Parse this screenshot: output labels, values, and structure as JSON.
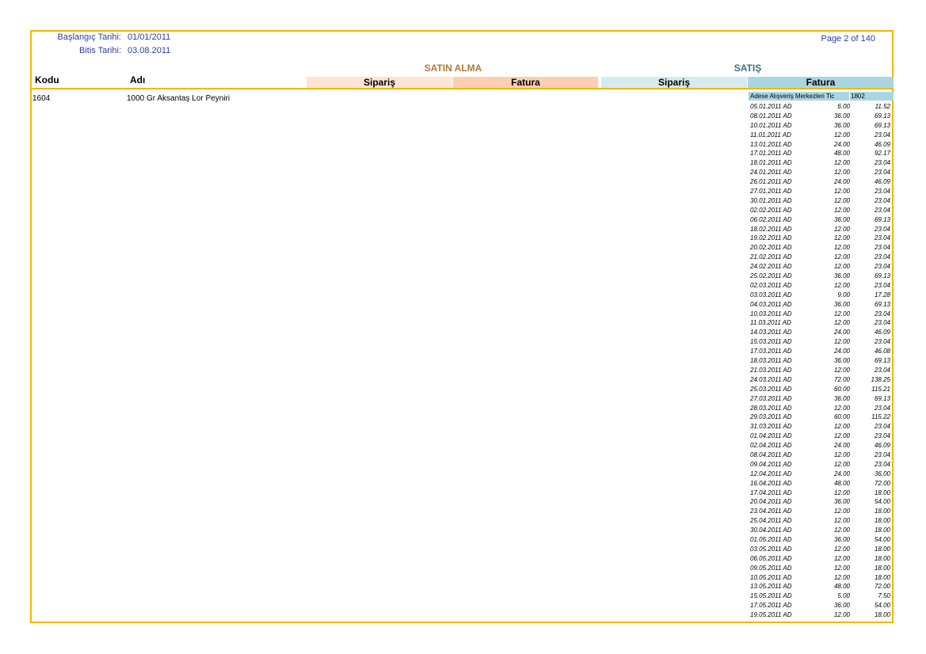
{
  "header": {
    "start_label": "Başlangıç Tarihi:",
    "start_value": "01/01/2011",
    "end_label": "Bitis Tarihi:",
    "end_value": "03.08.2011",
    "page": "Page 2 of 140"
  },
  "sections": {
    "purchase": "SATIN ALMA",
    "sales": "SATIŞ"
  },
  "columns": {
    "code": "Kodu",
    "name": "Adı",
    "purchase_order": "Sipariş",
    "purchase_invoice": "Fatura",
    "sales_order": "Sipariş",
    "sales_invoice": "Fatura"
  },
  "product": {
    "code": "1604",
    "name": "1000 Gr Aksantaş Lor Peyniri"
  },
  "customer": {
    "name": "Adese Alışveriş Merkezleri Tic",
    "code": "1802"
  },
  "lines": [
    {
      "date": "05.01.2011 AD",
      "qty": "6.00",
      "amount": "11.52"
    },
    {
      "date": "08.01.2011 AD",
      "qty": "36.00",
      "amount": "69.13"
    },
    {
      "date": "10.01.2011 AD",
      "qty": "36.00",
      "amount": "69.13"
    },
    {
      "date": "11.01.2011 AD",
      "qty": "12.00",
      "amount": "23.04"
    },
    {
      "date": "13.01.2011 AD",
      "qty": "24.00",
      "amount": "46.09"
    },
    {
      "date": "17.01.2011 AD",
      "qty": "48.00",
      "amount": "92.17"
    },
    {
      "date": "18.01.2011 AD",
      "qty": "12.00",
      "amount": "23.04"
    },
    {
      "date": "24.01.2011 AD",
      "qty": "12.00",
      "amount": "23.04"
    },
    {
      "date": "26.01.2011 AD",
      "qty": "24.00",
      "amount": "46.09"
    },
    {
      "date": "27.01.2011 AD",
      "qty": "12.00",
      "amount": "23.04"
    },
    {
      "date": "30.01.2011 AD",
      "qty": "12.00",
      "amount": "23.04"
    },
    {
      "date": "02.02.2011 AD",
      "qty": "12.00",
      "amount": "23.04"
    },
    {
      "date": "06.02.2011 AD",
      "qty": "36.00",
      "amount": "69.13"
    },
    {
      "date": "18.02.2011 AD",
      "qty": "12.00",
      "amount": "23.04"
    },
    {
      "date": "19.02.2011 AD",
      "qty": "12.00",
      "amount": "23.04"
    },
    {
      "date": "20.02.2011 AD",
      "qty": "12.00",
      "amount": "23.04"
    },
    {
      "date": "21.02.2011 AD",
      "qty": "12.00",
      "amount": "23.04"
    },
    {
      "date": "24.02.2011 AD",
      "qty": "12.00",
      "amount": "23.04"
    },
    {
      "date": "25.02.2011 AD",
      "qty": "36.00",
      "amount": "69.13"
    },
    {
      "date": "02.03.2011 AD",
      "qty": "12.00",
      "amount": "23.04"
    },
    {
      "date": "03.03.2011 AD",
      "qty": "9.00",
      "amount": "17.28"
    },
    {
      "date": "04.03.2011 AD",
      "qty": "36.00",
      "amount": "69.13"
    },
    {
      "date": "10.03.2011 AD",
      "qty": "12.00",
      "amount": "23.04"
    },
    {
      "date": "11.03.2011 AD",
      "qty": "12.00",
      "amount": "23.04"
    },
    {
      "date": "14.03.2011 AD",
      "qty": "24.00",
      "amount": "46.09"
    },
    {
      "date": "15.03.2011 AD",
      "qty": "12.00",
      "amount": "23.04"
    },
    {
      "date": "17.03.2011 AD",
      "qty": "24.00",
      "amount": "46.08"
    },
    {
      "date": "18.03.2011 AD",
      "qty": "36.00",
      "amount": "69.13"
    },
    {
      "date": "21.03.2011 AD",
      "qty": "12.00",
      "amount": "23.04"
    },
    {
      "date": "24.03.2011 AD",
      "qty": "72.00",
      "amount": "138.25"
    },
    {
      "date": "25.03.2011 AD",
      "qty": "60.00",
      "amount": "115.21"
    },
    {
      "date": "27.03.2011 AD",
      "qty": "36.00",
      "amount": "69.13"
    },
    {
      "date": "28.03.2011 AD",
      "qty": "12.00",
      "amount": "23.04"
    },
    {
      "date": "29.03.2011 AD",
      "qty": "60.00",
      "amount": "115.22"
    },
    {
      "date": "31.03.2011 AD",
      "qty": "12.00",
      "amount": "23.04"
    },
    {
      "date": "01.04.2011 AD",
      "qty": "12.00",
      "amount": "23.04"
    },
    {
      "date": "02.04.2011 AD",
      "qty": "24.00",
      "amount": "46.09"
    },
    {
      "date": "08.04.2011 AD",
      "qty": "12.00",
      "amount": "23.04"
    },
    {
      "date": "09.04.2011 AD",
      "qty": "12.00",
      "amount": "23.04"
    },
    {
      "date": "12.04.2011 AD",
      "qty": "24.00",
      "amount": "36.00"
    },
    {
      "date": "16.04.2011 AD",
      "qty": "48.00",
      "amount": "72.00"
    },
    {
      "date": "17.04.2011 AD",
      "qty": "12.00",
      "amount": "18.00"
    },
    {
      "date": "20.04.2011 AD",
      "qty": "36.00",
      "amount": "54.00"
    },
    {
      "date": "23.04.2011 AD",
      "qty": "12.00",
      "amount": "18.00"
    },
    {
      "date": "25.04.2011 AD",
      "qty": "12.00",
      "amount": "18.00"
    },
    {
      "date": "30.04.2011 AD",
      "qty": "12.00",
      "amount": "18.00"
    },
    {
      "date": "01.05.2011 AD",
      "qty": "36.00",
      "amount": "54.00"
    },
    {
      "date": "03.05.2011 AD",
      "qty": "12.00",
      "amount": "18.00"
    },
    {
      "date": "06.05.2011 AD",
      "qty": "12.00",
      "amount": "18.00"
    },
    {
      "date": "09.05.2011 AD",
      "qty": "12.00",
      "amount": "18.00"
    },
    {
      "date": "10.05.2011 AD",
      "qty": "12.00",
      "amount": "18.00"
    },
    {
      "date": "13.05.2011 AD",
      "qty": "48.00",
      "amount": "72.00"
    },
    {
      "date": "15.05.2011 AD",
      "qty": "5.00",
      "amount": "7.50"
    },
    {
      "date": "17.05.2011 AD",
      "qty": "36.00",
      "amount": "54.00"
    },
    {
      "date": "19.05.2011 AD",
      "qty": "12.00",
      "amount": "18.00"
    }
  ]
}
